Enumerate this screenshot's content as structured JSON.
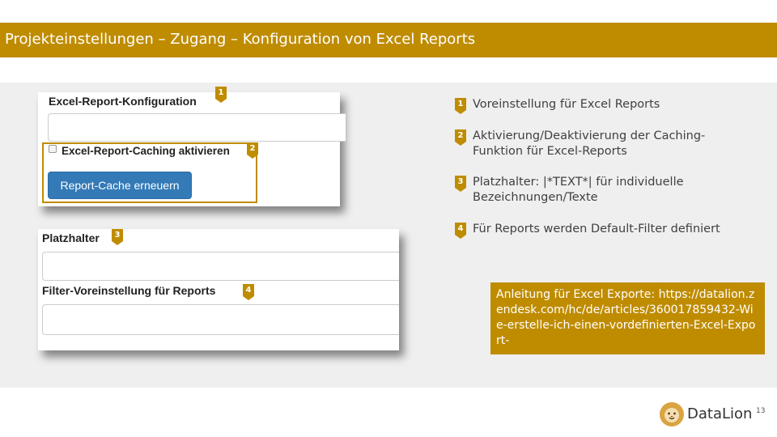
{
  "slide": {
    "title": "Projekteinstellungen – Zugang – Konfiguration von Excel Reports",
    "page_number": "13",
    "accent_color": "#bf8c00"
  },
  "screenshot1": {
    "field_label": "Excel-Report-Konfiguration",
    "checkbox_label": "Excel-Report-Caching aktivieren",
    "checkbox_checked": false,
    "button_label": "Report-Cache erneuern"
  },
  "screenshot2": {
    "placeholder_label": "Platzhalter",
    "filter_label": "Filter-Voreinstellung für Reports"
  },
  "markers": [
    "1",
    "2",
    "3",
    "4"
  ],
  "legend": [
    {
      "num": "1",
      "text": "Voreinstellung für Excel Reports"
    },
    {
      "num": "2",
      "text": "Aktivierung/Deaktivierung der Caching-Funktion für Excel-Reports"
    },
    {
      "num": "3",
      "text": "Platzhalter: |*TEXT*| für individuelle Bezeichnungen/Texte"
    },
    {
      "num": "4",
      "text": "Für Reports werden Default-Filter definiert"
    }
  ],
  "info_box": {
    "text": "Anleitung für Excel Exporte: https://datalion.zendesk.com/hc/de/articles/360017859432-Wie-erstelle-ich-einen-vordefinierten-Excel-Export-"
  },
  "logo": {
    "text": "DataLion",
    "icon": "lion-head-icon"
  }
}
